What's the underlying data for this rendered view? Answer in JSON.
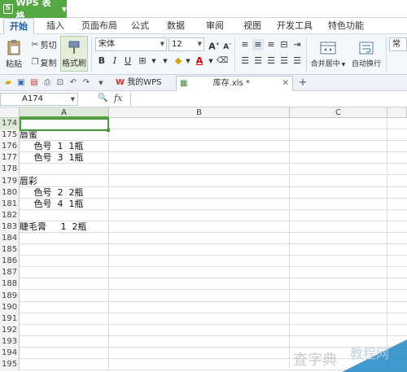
{
  "app": {
    "title": "WPS 表格",
    "logo": "S"
  },
  "menu": [
    "开始",
    "插入",
    "页面布局",
    "公式",
    "数据",
    "审阅",
    "视图",
    "开发工具",
    "特色功能"
  ],
  "ribbon": {
    "paste": "粘贴",
    "cut": "剪切",
    "copy": "复制",
    "format_painter": "格式刷",
    "font": "宋体",
    "font_size": "12",
    "merge_center": "合并居中",
    "wrap": "自动换行",
    "number_format": "常规"
  },
  "doc_tabs": [
    {
      "label": "我的WPS",
      "active": false
    },
    {
      "label": "库存.xls *",
      "active": true
    }
  ],
  "formula_bar": {
    "name_box": "A174",
    "fx": "fx",
    "content": ""
  },
  "columns": [
    "A",
    "B",
    "C"
  ],
  "rows": [
    {
      "n": "174",
      "a": ""
    },
    {
      "n": "175",
      "a": "唇蜜"
    },
    {
      "n": "176",
      "a": "     色号  1  1瓶"
    },
    {
      "n": "177",
      "a": "     色号  3  1瓶"
    },
    {
      "n": "178",
      "a": ""
    },
    {
      "n": "179",
      "a": "唇彩"
    },
    {
      "n": "180",
      "a": "     色号  2  2瓶"
    },
    {
      "n": "181",
      "a": "     色号  4  1瓶"
    },
    {
      "n": "182",
      "a": ""
    },
    {
      "n": "183",
      "a": "睫毛膏     1  2瓶"
    },
    {
      "n": "184",
      "a": ""
    },
    {
      "n": "185",
      "a": ""
    },
    {
      "n": "186",
      "a": ""
    },
    {
      "n": "187",
      "a": ""
    },
    {
      "n": "188",
      "a": ""
    },
    {
      "n": "189",
      "a": ""
    },
    {
      "n": "190",
      "a": ""
    },
    {
      "n": "191",
      "a": ""
    },
    {
      "n": "192",
      "a": ""
    },
    {
      "n": "193",
      "a": ""
    },
    {
      "n": "194",
      "a": ""
    },
    {
      "n": "195",
      "a": ""
    }
  ],
  "colors": {
    "accent": "#55a744",
    "selection": "#4a9a3c"
  }
}
